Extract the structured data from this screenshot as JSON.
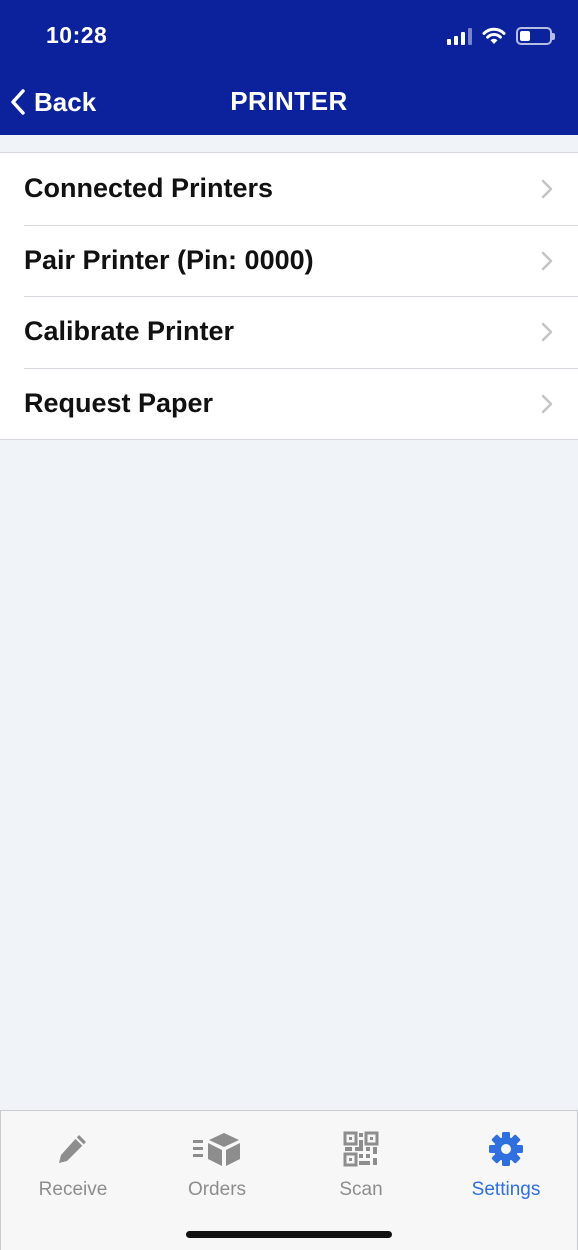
{
  "status_bar": {
    "time": "10:28",
    "battery_level": 0.35
  },
  "nav": {
    "back_label": "Back",
    "title": "PRINTER"
  },
  "menu": {
    "items": [
      {
        "label": "Connected Printers"
      },
      {
        "label": "Pair Printer (Pin: 0000)"
      },
      {
        "label": "Calibrate Printer"
      },
      {
        "label": "Request Paper"
      }
    ]
  },
  "tabbar": {
    "tabs": [
      {
        "label": "Receive",
        "icon": "pencil-icon",
        "active": false
      },
      {
        "label": "Orders",
        "icon": "box-icon",
        "active": false
      },
      {
        "label": "Scan",
        "icon": "qr-code-icon",
        "active": false
      },
      {
        "label": "Settings",
        "icon": "gear-icon",
        "active": true
      }
    ]
  },
  "colors": {
    "header_bg": "#0b229c",
    "active_tab": "#2f6fde",
    "inactive_tab": "#8d8d8d",
    "page_bg": "#f0f4f8"
  }
}
